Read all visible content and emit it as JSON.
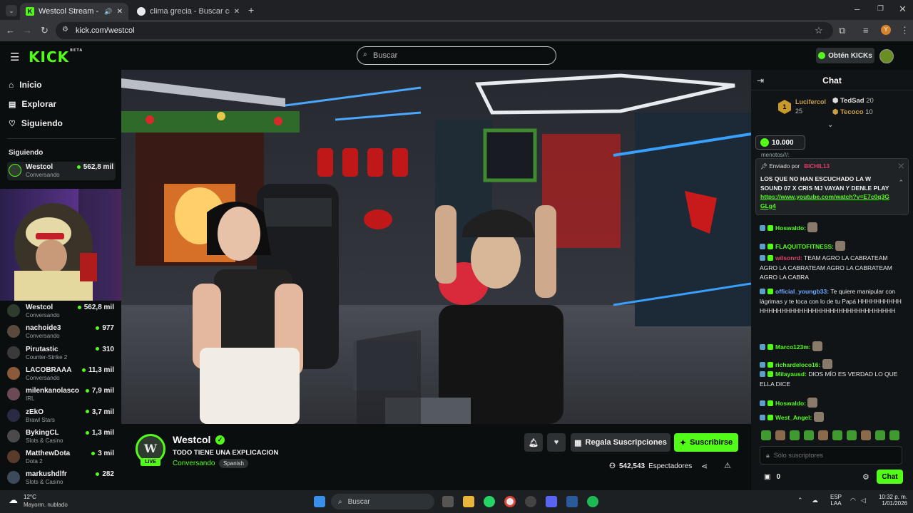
{
  "browser": {
    "tabs": [
      {
        "title": "Westcol Stream - Watch Li...",
        "active": true
      },
      {
        "title": "clima grecia - Buscar con Goog",
        "active": false
      }
    ],
    "url": "kick.com/westcol",
    "profile_initial": "Y"
  },
  "header": {
    "logo": "KICK",
    "logo_sup": "BETA",
    "search_placeholder": "Buscar",
    "get_kicks": "Obtén KICKs"
  },
  "sidebar": {
    "nav": [
      {
        "label": "Inicio",
        "icon": "home-icon"
      },
      {
        "label": "Explorar",
        "icon": "explore-icon"
      },
      {
        "label": "Siguiendo",
        "icon": "heart-icon"
      }
    ],
    "following_title": "Siguiendo",
    "following": [
      {
        "name": "Westcol",
        "category": "Conversando",
        "viewers": "562,8 mil"
      }
    ],
    "recommended": [
      {
        "name": "Westcol",
        "category": "Conversando",
        "viewers": "562,8 mil",
        "color": "#2f3b2f"
      },
      {
        "name": "nachoide3",
        "category": "Conversando",
        "viewers": "977",
        "color": "#5a4a3d"
      },
      {
        "name": "Pirutastic",
        "category": "Counter-Strike 2",
        "viewers": "310",
        "color": "#3a3a3a"
      },
      {
        "name": "LACOBRAAA",
        "category": "Conversando",
        "viewers": "11,3 mil",
        "color": "#8a5a3a"
      },
      {
        "name": "milenkanolasco",
        "category": "IRL",
        "viewers": "7,9 mil",
        "color": "#6b4a55"
      },
      {
        "name": "zEkO",
        "category": "Brawl Stars",
        "viewers": "3,7 mil",
        "color": "#2a2a44"
      },
      {
        "name": "BykingCL",
        "category": "Slots & Casino",
        "viewers": "1,3 mil",
        "color": "#4a4a4a"
      },
      {
        "name": "MatthewDota",
        "category": "Dota 2",
        "viewers": "3 mil",
        "color": "#5a3a2a"
      },
      {
        "name": "markushdlfr",
        "category": "Slots & Casino",
        "viewers": "282",
        "color": "#3d4a5a"
      }
    ]
  },
  "stream": {
    "streamer": "Westcol",
    "title": "TODO TIENE UNA EXPLICACION",
    "category": "Conversando",
    "language": "Spanish",
    "live_label": "LIVE",
    "viewers": "542,543",
    "viewers_label": "Espectadores",
    "gift_label": "Regala Suscripciones",
    "subscribe_label": "Suscribirse"
  },
  "chat": {
    "title": "Chat",
    "leaderboard": [
      {
        "rank": "1",
        "name": "Lucifercol",
        "count": "25"
      },
      {
        "name": "TedSad",
        "count": "20"
      },
      {
        "name": "Tecoco",
        "count": "10"
      }
    ],
    "kicks_pill": "10.000",
    "pinned": {
      "label": "Enviado por",
      "sender": "BICHIL13",
      "text": "LOS QUE NO HAN ESCUCHADO LA W SOUND 07 X CRIS MJ VAYAN Y DENLE PLAY",
      "link": "https://www.youtube.com/watch?v=E7c0q3GGLg4"
    },
    "partial_user": "menotos///:",
    "messages": [
      {
        "user": "Hoswaldo:",
        "color": "#53fc18",
        "text": ""
      },
      {
        "user": "FLAQUITOFITNESS:",
        "color": "#53fc18",
        "text": ""
      },
      {
        "user": "wilsonrd:",
        "color": "#e0406a",
        "text": "TEAM AGRO LA CABRATEAM AGRO LA CABRATEAM AGRO LA CABRATEAM AGRO LA CABRA"
      },
      {
        "user": "official_youngb33:",
        "color": "#6fa8ff",
        "text": "Te quiere manipular con lágrimas y te toca con lo de tu Papá"
      },
      {
        "user": "Marco123m:",
        "color": "#53fc18",
        "text": ""
      },
      {
        "user": "richardeloco16:",
        "color": "#53fc18",
        "text": ""
      },
      {
        "user": "Milayausd:",
        "color": "#53fc18",
        "text": "DIOS MÍO ES VERDAD LO QUE ELLA DICE"
      },
      {
        "user": "Hoswaldo:",
        "color": "#53fc18",
        "text": ""
      },
      {
        "user": "West_Angel:",
        "color": "#53fc18",
        "text": ""
      }
    ],
    "spam_text": "HHHHHHHHHHHHHHHHHHHHHHHHHHHHHHHHHHHHHHHHH",
    "input_placeholder": "Sólo suscriptores",
    "points": "0",
    "send_label": "Chat"
  },
  "taskbar": {
    "temp": "12°C",
    "weather": "Mayorm. nublado",
    "search": "Buscar",
    "lang": "ESP",
    "lang2": "LAA",
    "time": "10:32 p. m.",
    "date": "1/01/2026"
  }
}
